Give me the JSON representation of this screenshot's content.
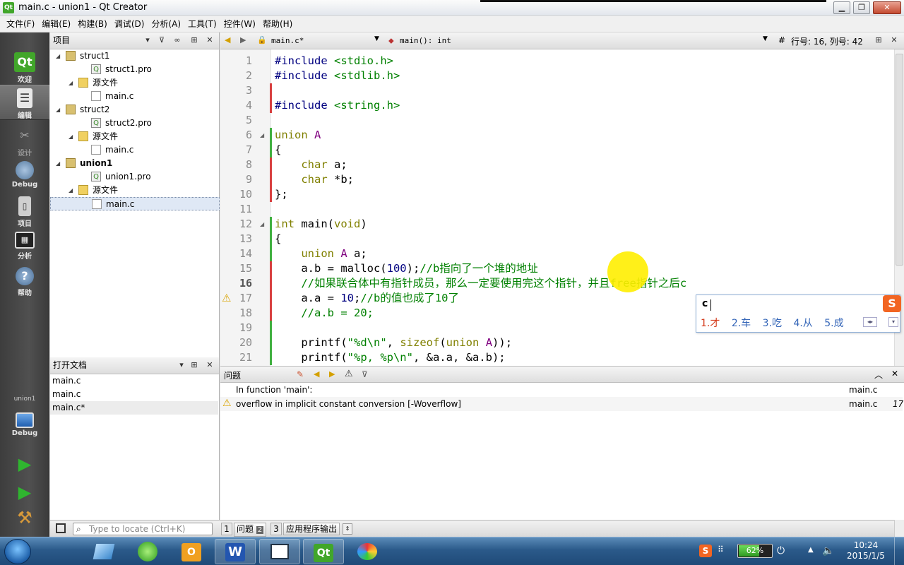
{
  "window": {
    "title": "main.c - union1 - Qt Creator",
    "app_icon": "Qt"
  },
  "menu": [
    "文件(F)",
    "编辑(E)",
    "构建(B)",
    "调试(D)",
    "分析(A)",
    "工具(T)",
    "控件(W)",
    "帮助(H)"
  ],
  "modes": [
    {
      "label": "欢迎",
      "icon": "qt-logo-icon"
    },
    {
      "label": "编辑",
      "icon": "edit-document-icon"
    },
    {
      "label": "设计",
      "icon": "design-tools-icon"
    },
    {
      "label": "Debug",
      "icon": "debug-bug-icon"
    },
    {
      "label": "项目",
      "icon": "project-book-icon"
    },
    {
      "label": "分析",
      "icon": "analyze-chart-icon"
    },
    {
      "label": "帮助",
      "icon": "help-question-icon"
    }
  ],
  "kit": {
    "project": "union1",
    "mode": "Debug"
  },
  "project_panel": {
    "title": "项目",
    "tree": [
      {
        "label": "struct1",
        "type": "project",
        "depth": 0,
        "bold": false
      },
      {
        "label": "struct1.pro",
        "type": "pro",
        "depth": 1,
        "bold": false
      },
      {
        "label": "源文件",
        "type": "folder",
        "depth": 1,
        "bold": false
      },
      {
        "label": "main.c",
        "type": "file",
        "depth": 2,
        "bold": false
      },
      {
        "label": "struct2",
        "type": "project",
        "depth": 0,
        "bold": false
      },
      {
        "label": "struct2.pro",
        "type": "pro",
        "depth": 1,
        "bold": false
      },
      {
        "label": "源文件",
        "type": "folder",
        "depth": 1,
        "bold": false
      },
      {
        "label": "main.c",
        "type": "file",
        "depth": 2,
        "bold": false
      },
      {
        "label": "union1",
        "type": "project",
        "depth": 0,
        "bold": true
      },
      {
        "label": "union1.pro",
        "type": "pro",
        "depth": 1,
        "bold": false
      },
      {
        "label": "源文件",
        "type": "folder",
        "depth": 1,
        "bold": false
      },
      {
        "label": "main.c",
        "type": "file",
        "depth": 2,
        "bold": false,
        "selected": true
      }
    ]
  },
  "open_docs": {
    "title": "打开文档",
    "items": [
      "main.c",
      "main.c",
      "main.c*"
    ]
  },
  "editor_toolbar": {
    "file": "main.c*",
    "symbol": "main(): int",
    "hash": "#",
    "position": "行号: 16, 列号: 42"
  },
  "code": {
    "current_line": 16,
    "lines": [
      {
        "n": "1",
        "text": "#include <stdio.h>"
      },
      {
        "n": "2",
        "text": "#include <stdlib.h>"
      },
      {
        "n": "3",
        "text": ""
      },
      {
        "n": "4",
        "text": "#include <string.h>"
      },
      {
        "n": "5",
        "text": ""
      },
      {
        "n": "6",
        "text": "union A"
      },
      {
        "n": "7",
        "text": "{"
      },
      {
        "n": "8",
        "text": "    char a;"
      },
      {
        "n": "9",
        "text": "    char *b;"
      },
      {
        "n": "10",
        "text": "};"
      },
      {
        "n": "11",
        "text": ""
      },
      {
        "n": "12",
        "text": "int main(void)"
      },
      {
        "n": "13",
        "text": "{"
      },
      {
        "n": "14",
        "text": "    union A a;"
      },
      {
        "n": "15",
        "text": "    a.b = malloc(100);//b指向了一个堆的地址"
      },
      {
        "n": "16",
        "text": "    //如果联合体中有指针成员，那么一定要使用完这个指针，并且free指针之后c"
      },
      {
        "n": "17",
        "text": "    a.a = 10;//b的值也成了10了"
      },
      {
        "n": "18",
        "text": "    //a.b = 20;"
      },
      {
        "n": "19",
        "text": ""
      },
      {
        "n": "20",
        "text": "    printf(\"%d\\n\", sizeof(union A));"
      },
      {
        "n": "21",
        "text": "    printf(\"%p, %p\\n\", &a.a, &a.b);"
      }
    ]
  },
  "ime": {
    "input": "c",
    "candidates": [
      "1.才",
      "2.车",
      "3.吃",
      "4.从",
      "5.成"
    ],
    "logo": "S"
  },
  "issues": {
    "title": "问题",
    "rows": [
      {
        "text": "In function 'main':",
        "file": "main.c",
        "line": "",
        "warning": false
      },
      {
        "text": "overflow in implicit constant conversion [-Woverflow]",
        "file": "main.c",
        "line": "17",
        "warning": true
      }
    ]
  },
  "statusbar": {
    "locate_placeholder": "Type to locate (Ctrl+K)",
    "tabs": [
      {
        "n": "1",
        "label": "问题",
        "badge": "2"
      },
      {
        "n": "3",
        "label": "应用程序输出"
      }
    ]
  },
  "taskbar": {
    "time": "10:24",
    "date": "2015/1/5",
    "battery": "62%",
    "battery_level": 0.62,
    "apps": [
      "ie",
      "browser",
      "outlook",
      "W",
      "presentation",
      "Qt",
      "paint"
    ]
  }
}
